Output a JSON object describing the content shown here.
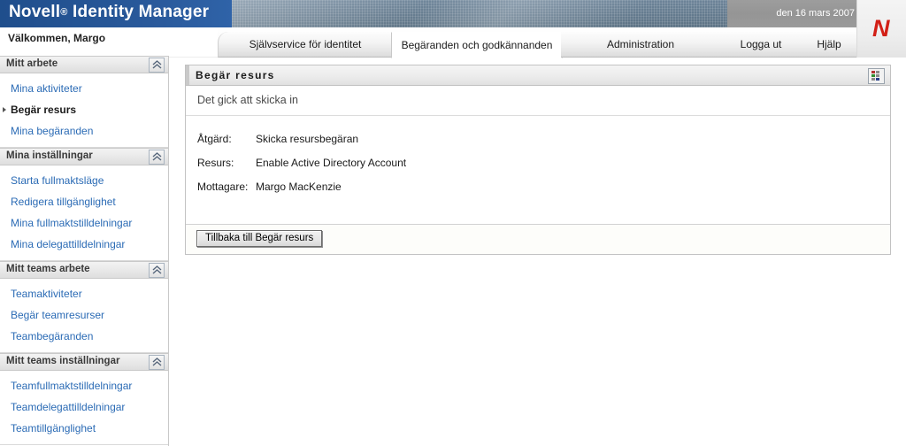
{
  "banner": {
    "product_name": "Novell",
    "registered_mark": "®",
    "product_suffix": "Identity Manager",
    "date": "den 16 mars 2007",
    "logo_letter": "N",
    "brand_color": "#1f4e8c",
    "logo_color": "#d21f16"
  },
  "welcome": {
    "text": "Välkommen, Margo"
  },
  "tabs": [
    {
      "label": "Självservice för identitet",
      "active": false
    },
    {
      "label": "Begäranden och godkännanden",
      "active": true
    },
    {
      "label": "Administration",
      "active": false
    },
    {
      "label": "Logga ut",
      "active": false
    },
    {
      "label": "Hjälp",
      "active": false
    }
  ],
  "sidebar": {
    "sections": [
      {
        "title": "Mitt arbete",
        "collapse_icon": "chevron-double-up-icon",
        "items": [
          {
            "label": "Mina aktiviteter",
            "selected": false
          },
          {
            "label": "Begär resurs",
            "selected": true
          },
          {
            "label": "Mina begäranden",
            "selected": false
          }
        ]
      },
      {
        "title": "Mina inställningar",
        "collapse_icon": "chevron-double-up-icon",
        "items": [
          {
            "label": "Starta fullmaktsläge",
            "selected": false
          },
          {
            "label": "Redigera tillgänglighet",
            "selected": false
          },
          {
            "label": "Mina fullmaktstilldelningar",
            "selected": false
          },
          {
            "label": "Mina delegattilldelningar",
            "selected": false
          }
        ]
      },
      {
        "title": "Mitt teams arbete",
        "collapse_icon": "chevron-double-up-icon",
        "items": [
          {
            "label": "Teamaktiviteter",
            "selected": false
          },
          {
            "label": "Begär teamresurser",
            "selected": false
          },
          {
            "label": "Teambegäranden",
            "selected": false
          }
        ]
      },
      {
        "title": "Mitt teams inställningar",
        "collapse_icon": "chevron-double-up-icon",
        "items": [
          {
            "label": "Teamfullmaktstilldelningar",
            "selected": false
          },
          {
            "label": "Teamdelegattilldelningar",
            "selected": false
          },
          {
            "label": "Teamtillgänglighet",
            "selected": false
          }
        ]
      }
    ]
  },
  "panel": {
    "title": "Begär resurs",
    "tool_icon": "color-grid-icon",
    "tool_icon_colors": [
      "#b03030",
      "#8a8a8a",
      "#2e8b2e",
      "#8a8a8a",
      "#8a8a8a",
      "#27408b"
    ],
    "status_message": "Det gick att skicka in",
    "details": [
      {
        "label": "Åtgärd:",
        "value": "Skicka resursbegäran"
      },
      {
        "label": "Resurs:",
        "value": "Enable Active Directory Account"
      },
      {
        "label": "Mottagare:",
        "value": "Margo MacKenzie"
      }
    ],
    "back_button": "Tillbaka till Begär resurs"
  }
}
